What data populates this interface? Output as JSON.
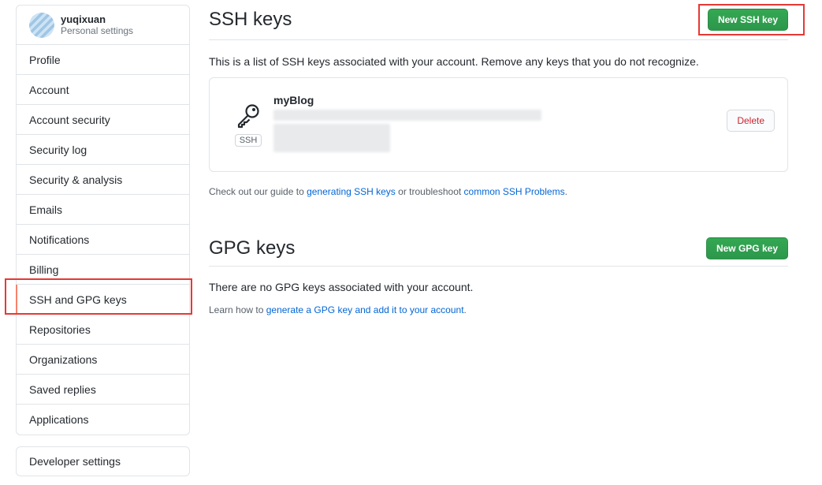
{
  "user": {
    "name": "yuqixuan",
    "subtitle": "Personal settings"
  },
  "sidebar": {
    "items": [
      {
        "label": "Profile"
      },
      {
        "label": "Account"
      },
      {
        "label": "Account security"
      },
      {
        "label": "Security log"
      },
      {
        "label": "Security & analysis"
      },
      {
        "label": "Emails"
      },
      {
        "label": "Notifications"
      },
      {
        "label": "Billing"
      },
      {
        "label": "SSH and GPG keys"
      },
      {
        "label": "Repositories"
      },
      {
        "label": "Organizations"
      },
      {
        "label": "Saved replies"
      },
      {
        "label": "Applications"
      }
    ],
    "selected_label": "SSH and GPG keys",
    "developer_settings": "Developer settings"
  },
  "ssh": {
    "title": "SSH keys",
    "new_button": "New SSH key",
    "description": "This is a list of SSH keys associated with your account. Remove any keys that you do not recognize.",
    "key": {
      "title": "myBlog",
      "type_label": "SSH",
      "delete_label": "Delete"
    },
    "guide_prefix": "Check out our guide to ",
    "guide_link1": "generating SSH keys",
    "guide_mid": " or troubleshoot ",
    "guide_link2": "common SSH Problems",
    "guide_suffix": "."
  },
  "gpg": {
    "title": "GPG keys",
    "new_button": "New GPG key",
    "empty_text": "There are no GPG keys associated with your account.",
    "learn_prefix": "Learn how to ",
    "learn_link": "generate a GPG key and add it to your account",
    "learn_suffix": "."
  },
  "colors": {
    "green": "#2c974b",
    "danger": "#cb2431",
    "link": "#0366d6",
    "selected_marker": "#f9826c",
    "annotation": "#e53935"
  }
}
